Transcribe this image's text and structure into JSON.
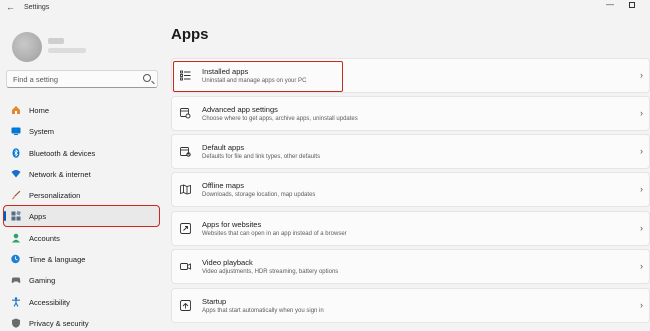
{
  "window": {
    "title": "Settings",
    "back_icon": "←",
    "minimize_icon": "—"
  },
  "search": {
    "placeholder": "Find a setting"
  },
  "sidebar": {
    "items": [
      {
        "label": "Home",
        "icon": "home-icon",
        "color": "#e08a2e"
      },
      {
        "label": "System",
        "icon": "system-icon",
        "color": "#0078d4"
      },
      {
        "label": "Bluetooth & devices",
        "icon": "bluetooth-icon",
        "color": "#0078d4"
      },
      {
        "label": "Network & internet",
        "icon": "network-icon",
        "color": "#1a6fc9"
      },
      {
        "label": "Personalization",
        "icon": "brush-icon",
        "color": "#d9723a"
      },
      {
        "label": "Apps",
        "icon": "apps-icon",
        "color": "#5a6b86",
        "active": true
      },
      {
        "label": "Accounts",
        "icon": "accounts-icon",
        "color": "#2ea36b"
      },
      {
        "label": "Time & language",
        "icon": "time-language-icon",
        "color": "#1a7fd6"
      },
      {
        "label": "Gaming",
        "icon": "gaming-icon",
        "color": "#6b6b6b"
      },
      {
        "label": "Accessibility",
        "icon": "accessibility-icon",
        "color": "#1a6fc9"
      },
      {
        "label": "Privacy & security",
        "icon": "shield-icon",
        "color": "#6b6b6b"
      }
    ]
  },
  "main": {
    "title": "Apps",
    "cards": [
      {
        "title": "Installed apps",
        "desc": "Uninstall and manage apps on your PC",
        "icon": "list-icon"
      },
      {
        "title": "Advanced app settings",
        "desc": "Choose where to get apps, archive apps, uninstall updates",
        "icon": "app-settings-icon"
      },
      {
        "title": "Default apps",
        "desc": "Defaults for file and link types, other defaults",
        "icon": "default-apps-icon"
      },
      {
        "title": "Offline maps",
        "desc": "Downloads, storage location, map updates",
        "icon": "map-icon"
      },
      {
        "title": "Apps for websites",
        "desc": "Websites that can open in an app instead of a browser",
        "icon": "link-icon"
      },
      {
        "title": "Video playback",
        "desc": "Video adjustments, HDR streaming, battery options",
        "icon": "video-icon"
      },
      {
        "title": "Startup",
        "desc": "Apps that start automatically when you sign in",
        "icon": "startup-icon"
      }
    ]
  },
  "colors": {
    "accent": "#005fb8",
    "highlight": "#c42b1c"
  }
}
